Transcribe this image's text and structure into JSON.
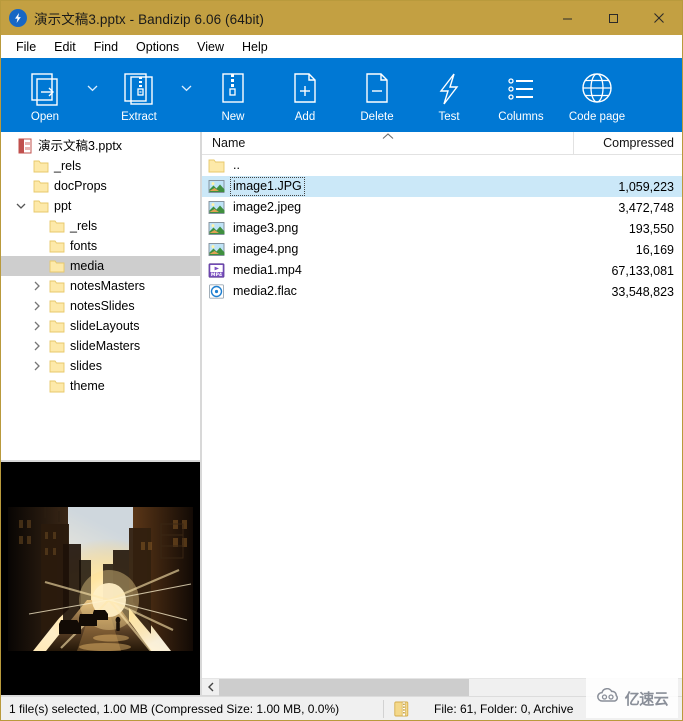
{
  "window": {
    "title": "演示文稿3.pptx - Bandizip 6.06 (64bit)",
    "app_icon": "bandizip-lightning-icon",
    "titlebar_color": "#c3a042",
    "accent_color": "#0078d4",
    "minimize_label": "Minimize",
    "maximize_label": "Maximize",
    "close_label": "Close"
  },
  "menubar": {
    "items": [
      {
        "label": "File"
      },
      {
        "label": "Edit"
      },
      {
        "label": "Find"
      },
      {
        "label": "Options"
      },
      {
        "label": "View"
      },
      {
        "label": "Help"
      }
    ]
  },
  "toolbar": {
    "buttons": [
      {
        "label": "Open",
        "icon": "open-archive-icon",
        "has_dropdown": true
      },
      {
        "label": "Extract",
        "icon": "extract-icon",
        "has_dropdown": true
      },
      {
        "label": "New",
        "icon": "new-archive-icon",
        "has_dropdown": false
      },
      {
        "label": "Add",
        "icon": "add-file-icon",
        "has_dropdown": false
      },
      {
        "label": "Delete",
        "icon": "delete-file-icon",
        "has_dropdown": false
      },
      {
        "label": "Test",
        "icon": "test-lightning-icon",
        "has_dropdown": false
      },
      {
        "label": "Columns",
        "icon": "columns-list-icon",
        "has_dropdown": false
      },
      {
        "label": "Code page",
        "icon": "codepage-globe-icon",
        "has_dropdown": false
      }
    ]
  },
  "tree": {
    "nodes": [
      {
        "label": "演示文稿3.pptx",
        "depth": 0,
        "twisty": "none",
        "icon": "pptx-file-icon",
        "selected": false
      },
      {
        "label": "_rels",
        "depth": 1,
        "twisty": "none",
        "icon": "folder-icon",
        "selected": false
      },
      {
        "label": "docProps",
        "depth": 1,
        "twisty": "none",
        "icon": "folder-icon",
        "selected": false
      },
      {
        "label": "ppt",
        "depth": 1,
        "twisty": "expanded",
        "icon": "folder-icon",
        "selected": false
      },
      {
        "label": "_rels",
        "depth": 2,
        "twisty": "none",
        "icon": "folder-icon",
        "selected": false
      },
      {
        "label": "fonts",
        "depth": 2,
        "twisty": "none",
        "icon": "folder-icon",
        "selected": false
      },
      {
        "label": "media",
        "depth": 2,
        "twisty": "none",
        "icon": "folder-icon",
        "selected": true
      },
      {
        "label": "notesMasters",
        "depth": 2,
        "twisty": "collapsed",
        "icon": "folder-icon",
        "selected": false
      },
      {
        "label": "notesSlides",
        "depth": 2,
        "twisty": "collapsed",
        "icon": "folder-icon",
        "selected": false
      },
      {
        "label": "slideLayouts",
        "depth": 2,
        "twisty": "collapsed",
        "icon": "folder-icon",
        "selected": false
      },
      {
        "label": "slideMasters",
        "depth": 2,
        "twisty": "collapsed",
        "icon": "folder-icon",
        "selected": false
      },
      {
        "label": "slides",
        "depth": 2,
        "twisty": "collapsed",
        "icon": "folder-icon",
        "selected": false
      },
      {
        "label": "theme",
        "depth": 2,
        "twisty": "none",
        "icon": "folder-icon",
        "selected": false
      }
    ]
  },
  "preview": {
    "description": "sunset-street-photo-preview"
  },
  "filelist": {
    "columns": [
      {
        "label": "Name",
        "sort": "ascending"
      },
      {
        "label": "Compressed"
      }
    ],
    "rows": [
      {
        "name": "..",
        "compressed": "",
        "icon": "folder-icon",
        "selected": false
      },
      {
        "name": "image1.JPG",
        "compressed": "1,059,223",
        "icon": "image-file-icon",
        "selected": true
      },
      {
        "name": "image2.jpeg",
        "compressed": "3,472,748",
        "icon": "image-file-icon",
        "selected": false
      },
      {
        "name": "image3.png",
        "compressed": "193,550",
        "icon": "image-file-icon",
        "selected": false
      },
      {
        "name": "image4.png",
        "compressed": "16,169",
        "icon": "image-file-icon",
        "selected": false
      },
      {
        "name": "media1.mp4",
        "compressed": "67,133,081",
        "icon": "mp4-file-icon",
        "selected": false
      },
      {
        "name": "media2.flac",
        "compressed": "33,548,823",
        "icon": "flac-audio-icon",
        "selected": false
      }
    ]
  },
  "statusbar": {
    "selection_text": "1 file(s) selected, 1.00 MB (Compressed Size: 1.00 MB, 0.0%)",
    "archive_icon": "archive-icon",
    "archive_text": "File: 61, Folder: 0, Archive"
  },
  "watermark": {
    "text": "亿速云",
    "icon": "cloud-logo-icon"
  }
}
